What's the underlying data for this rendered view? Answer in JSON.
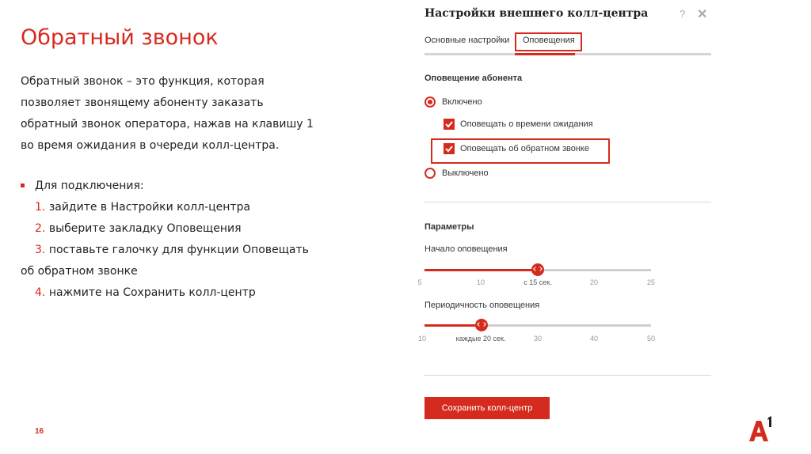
{
  "slide": {
    "title": "Обратный звонок",
    "description": [
      "Обратный звонок – это функция, которая",
      "позволяет звонящему абоненту заказать",
      "обратный звонок оператора, нажав на клавишу 1",
      "во время ожидания в очереди колл-центра."
    ],
    "connect_heading": "Для подключения:",
    "steps": [
      {
        "num": "1.",
        "text": "зайдите в Настройки колл-центра"
      },
      {
        "num": "2.",
        "text": "выберите закладку Оповещения"
      },
      {
        "num": "3.",
        "text": "поставьте галочку для функции Оповещать"
      },
      {
        "num": "",
        "text": "об обратном звонке"
      },
      {
        "num": "4.",
        "text": "нажмите на Сохранить колл-центр"
      }
    ],
    "page_number": "16",
    "accent_color": "#d52b1e"
  },
  "dialog": {
    "title": "Настройки внешнего колл-центра",
    "help_icon": "?",
    "close_icon": "✕",
    "tabs": [
      {
        "label": "Основные настройки",
        "active": false
      },
      {
        "label": "Оповещения",
        "active": true
      }
    ],
    "notification": {
      "heading": "Оповещение абонента",
      "on_label": "Включено",
      "off_label": "Выключено",
      "selected": "on",
      "checkboxes": [
        {
          "label": "Оповещать о времени ожидания",
          "checked": true
        },
        {
          "label": "Оповещать об обратном звонке",
          "checked": true
        }
      ]
    },
    "params": {
      "heading": "Параметры",
      "start": {
        "label": "Начало оповещения",
        "value": 15,
        "min": 5,
        "max": 25,
        "ticks": [
          "5",
          "10",
          "с 15 сек.",
          "20",
          "25"
        ]
      },
      "period": {
        "label": "Периодичность оповещения",
        "value": 20,
        "min": 10,
        "max": 50,
        "ticks": [
          "10",
          "каждые 20 сек.",
          "30",
          "40",
          "50"
        ]
      }
    },
    "save_label": "Сохранить колл-центр"
  }
}
